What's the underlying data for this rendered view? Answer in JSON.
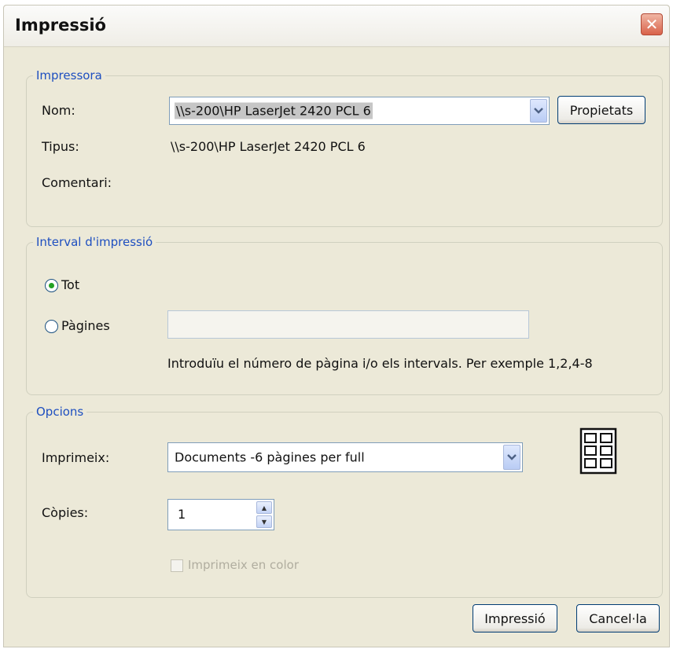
{
  "window": {
    "title": "Impressió",
    "close_glyph": "✕"
  },
  "printer_group": {
    "legend": "Impressora",
    "name_label": "Nom:",
    "name_value": "\\\\s-200\\HP LaserJet 2420 PCL 6",
    "properties_button": "Propietats",
    "type_label": "Tipus:",
    "type_value": "\\\\s-200\\HP LaserJet 2420 PCL 6",
    "comment_label": "Comentari:"
  },
  "range_group": {
    "legend": "Interval d'impressió",
    "all_label": "Tot",
    "all_selected": true,
    "pages_label": "Pàgines",
    "pages_value": "",
    "hint": "Introduïu el número de pàgina i/o els intervals.  Per exemple 1,2,4-8"
  },
  "options_group": {
    "legend": "Opcions",
    "print_label": "Imprimeix:",
    "print_value": "Documents -6 pàgines per full",
    "layout_icon": "six-pages-per-sheet-icon",
    "copies_label": "Còpies:",
    "copies_value": "1",
    "color_label": "Imprimeix en color",
    "color_enabled": false
  },
  "footer": {
    "ok_button": "Impressió",
    "cancel_button": "Cancel·la"
  },
  "colors": {
    "legend": "#1e4fc0",
    "dialog_bg": "#ece9d8",
    "close_button": "#d9624a",
    "radio_dot": "#23a123",
    "disabled_text": "#b0ad9f"
  }
}
